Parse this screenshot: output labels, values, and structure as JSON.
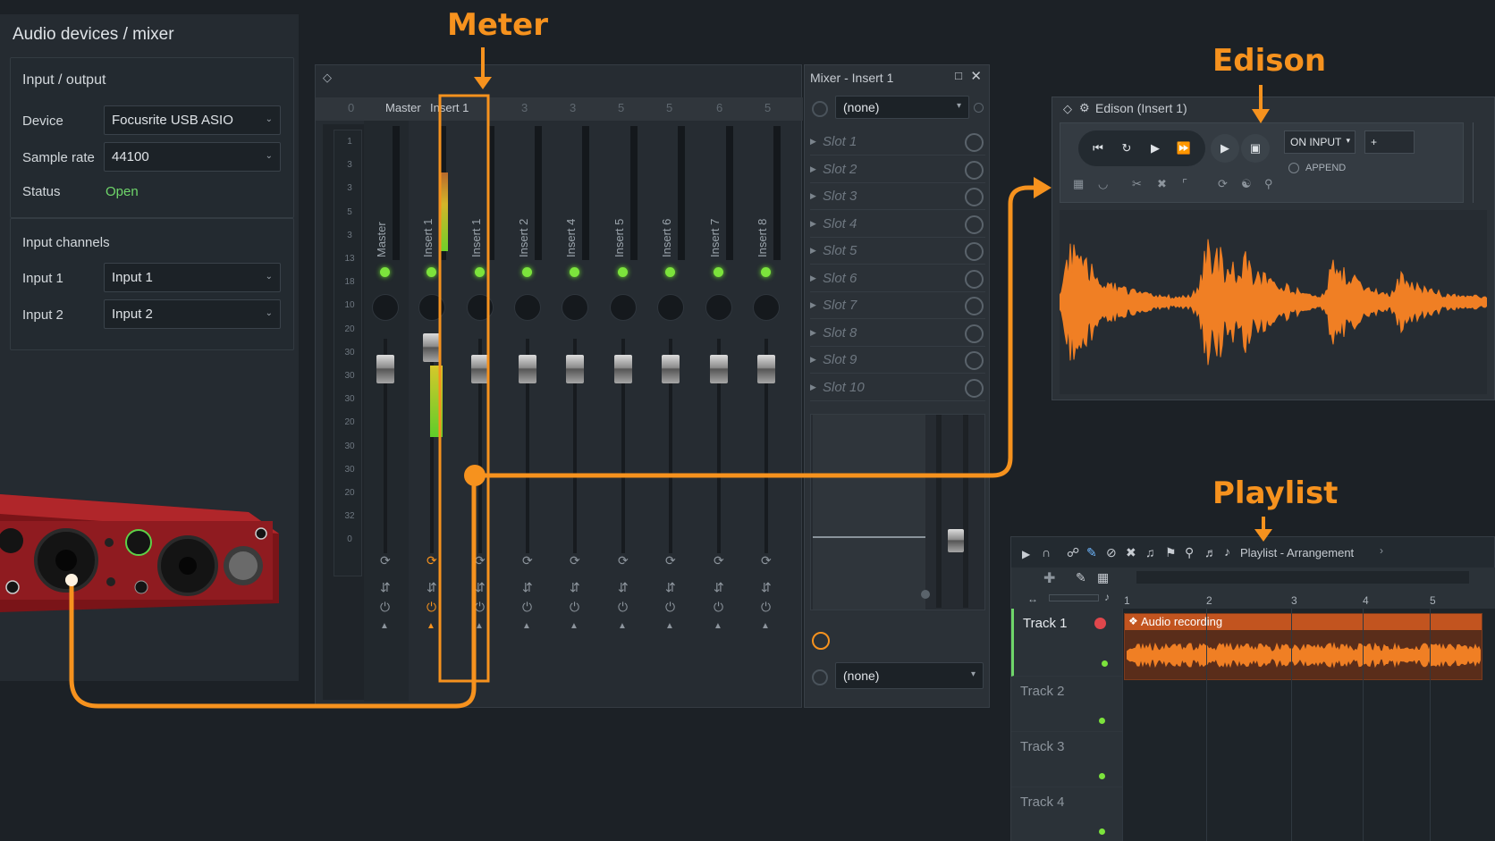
{
  "audio_panel": {
    "title": "Audio devices / mixer",
    "io_header": "Input / output",
    "device_label": "Device",
    "device_value": "Focusrite USB ASIO",
    "sample_rate_label": "Sample rate",
    "sample_rate_value": "44100",
    "status_label": "Status",
    "status_value": "Open",
    "channels_header": "Input channels",
    "input1_label": "Input 1",
    "input1_value": "Input 1",
    "input2_label": "Input 2",
    "input2_value": "Input 2"
  },
  "callouts": {
    "meter": "Meter",
    "edison": "Edison",
    "playlist": "Playlist"
  },
  "mixer": {
    "header_labels": [
      "0",
      "Master",
      "Insert 1",
      "3",
      "3",
      "5",
      "5",
      "6",
      "5"
    ],
    "strips": [
      "Master",
      "Insert 1",
      "Insert 1",
      "Insert 2",
      "Insert 4",
      "Insert 5",
      "Insert 6",
      "Insert 7",
      "Insert 8"
    ],
    "scale": [
      "1",
      "3",
      "3",
      "5",
      "3",
      "13",
      "18",
      "10",
      "20",
      "30",
      "30",
      "30",
      "20",
      "30",
      "30",
      "20",
      "32",
      "0"
    ]
  },
  "insert_panel": {
    "title": "Mixer - Insert 1",
    "top_select": "(none)",
    "bottom_select": "(none)",
    "slots": [
      "Slot 1",
      "Slot 2",
      "Slot 3",
      "Slot 4",
      "Slot 5",
      "Slot 6",
      "Slot 7",
      "Slot 8",
      "Slot 9",
      "Slot 10"
    ]
  },
  "edison": {
    "title": "Edison (Insert 1)",
    "mode": "ON INPUT",
    "field": "+",
    "append": "APPEND"
  },
  "playlist": {
    "title": "Playlist - Arrangement",
    "bar_numbers": [
      "1",
      "2",
      "3",
      "4",
      "5"
    ],
    "tracks": [
      "Track 1",
      "Track 2",
      "Track 3",
      "Track 4"
    ],
    "clip_label": "Audio recording"
  },
  "colors": {
    "accent": "#f6921e",
    "meter_green": "#7ce33c",
    "status_open": "#6fd66a",
    "waveform": "#f07f24"
  }
}
